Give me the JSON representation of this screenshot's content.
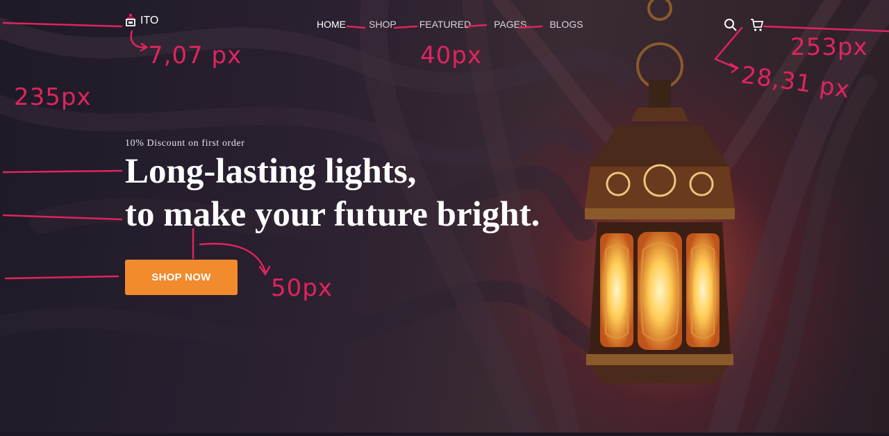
{
  "brand": {
    "name": "ITO",
    "icon": "lantern-logo-icon"
  },
  "nav": {
    "items": [
      "HOME",
      "SHOP",
      "FEATURED",
      "PAGES",
      "BLOGS"
    ],
    "active": "HOME"
  },
  "header_icons": [
    "search-icon",
    "cart-icon"
  ],
  "hero": {
    "discount": "10% Discount on first order",
    "headline_line1": "Long-lasting lights,",
    "headline_line2": "to make your future bright.",
    "cta_label": "SHOP NOW"
  },
  "annotations": {
    "logo_gap": "7,07 px",
    "nav_gap": "40px",
    "icons_gap": "28,31 px",
    "right_margin": "253px",
    "left_margin": "235px",
    "cta_gap": "50px"
  },
  "colors": {
    "accent": "#f28a2e",
    "annotation": "#e0245e",
    "background": "#1c1722"
  }
}
